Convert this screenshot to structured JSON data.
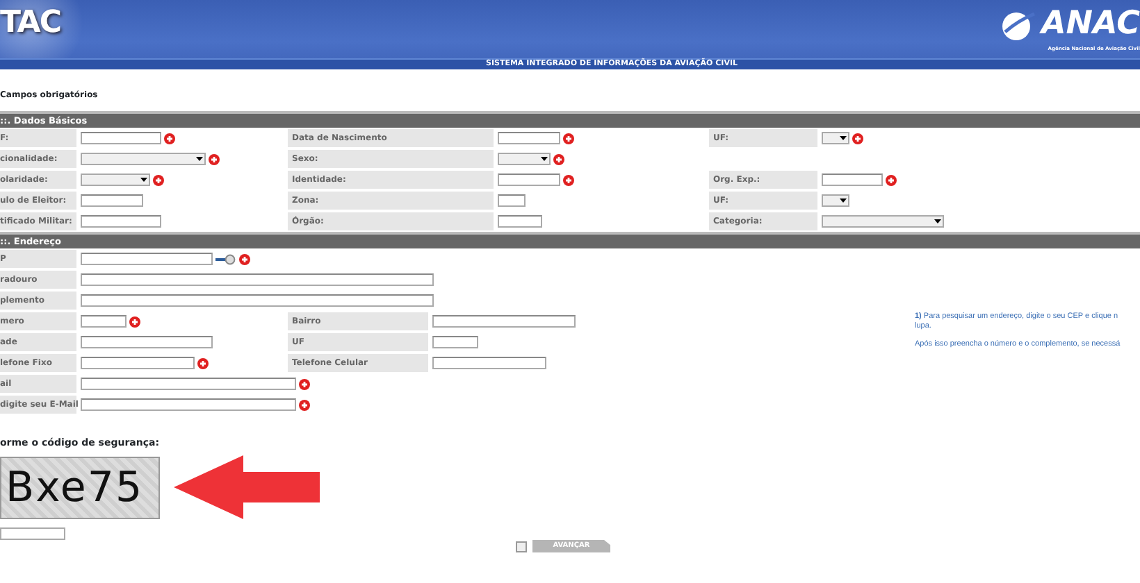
{
  "header": {
    "logo": "TAC",
    "brand": "ANAC",
    "brand_sub": "Agência Nacional de Aviação Civil",
    "system_title": "SISTEMA INTEGRADO DE INFORMAÇÕES DA AVIAÇÃO CIVIL"
  },
  "required_note": "Campos obrigatórios",
  "sections": [
    {
      "title": "::. Dados Básicos",
      "rows": [
        {
          "pairs": [
            {
              "label": "F:",
              "field": {
                "kind": "text",
                "required": true
              }
            },
            {
              "label": "Data de Nascimento",
              "field": {
                "kind": "text",
                "required": true
              }
            },
            {
              "label": "UF:",
              "field": {
                "kind": "select",
                "required": true
              }
            }
          ]
        },
        {
          "pairs": [
            {
              "label": "cionalidade:",
              "field": {
                "kind": "select",
                "required": true
              }
            },
            {
              "label": "Sexo:",
              "field": {
                "kind": "select",
                "required": true
              }
            }
          ]
        },
        {
          "pairs": [
            {
              "label": "olaridade:",
              "field": {
                "kind": "select",
                "required": true
              }
            },
            {
              "label": "Identidade:",
              "field": {
                "kind": "text",
                "required": true
              }
            },
            {
              "label": "Org. Exp.:",
              "field": {
                "kind": "text",
                "required": true
              }
            }
          ]
        },
        {
          "pairs": [
            {
              "label": "ulo de Eleitor:",
              "field": {
                "kind": "text",
                "required": false
              }
            },
            {
              "label": "Zona:",
              "field": {
                "kind": "text",
                "required": false
              }
            },
            {
              "label": "UF:",
              "field": {
                "kind": "select",
                "required": false
              }
            }
          ]
        },
        {
          "pairs": [
            {
              "label": "tificado Militar:",
              "field": {
                "kind": "text",
                "required": false
              }
            },
            {
              "label": "Órgão:",
              "field": {
                "kind": "text",
                "required": false
              }
            },
            {
              "label": "Categoria:",
              "field": {
                "kind": "select",
                "required": false
              }
            }
          ]
        }
      ]
    },
    {
      "title": "::. Endereço",
      "rows": [
        {
          "pairs": [
            {
              "label": "P",
              "field": {
                "kind": "text",
                "required": true,
                "lookup": true
              }
            }
          ]
        },
        {
          "pairs": [
            {
              "label": "radouro",
              "field": {
                "kind": "text",
                "required": false
              }
            }
          ]
        },
        {
          "pairs": [
            {
              "label": "plemento",
              "field": {
                "kind": "text",
                "required": false
              }
            }
          ]
        },
        {
          "pairs": [
            {
              "label": "mero",
              "field": {
                "kind": "text",
                "required": true
              }
            },
            {
              "label": "Bairro",
              "field": {
                "kind": "text",
                "required": false
              }
            }
          ]
        },
        {
          "pairs": [
            {
              "label": "ade",
              "field": {
                "kind": "text",
                "required": false
              }
            },
            {
              "label": "UF",
              "field": {
                "kind": "text",
                "required": false
              }
            }
          ]
        },
        {
          "pairs": [
            {
              "label": "lefone Fixo",
              "field": {
                "kind": "text",
                "required": true
              }
            },
            {
              "label": "Telefone Celular",
              "field": {
                "kind": "text",
                "required": false
              }
            }
          ]
        },
        {
          "pairs": [
            {
              "label": "ail",
              "field": {
                "kind": "text",
                "required": true
              }
            }
          ]
        },
        {
          "pairs": [
            {
              "label": "digite seu E-Mail",
              "field": {
                "kind": "text",
                "required": true
              }
            }
          ]
        }
      ],
      "help": [
        {
          "lines": [
            "**1)** Para pesquisar um endereço, digite o seu CEP e clique n",
            "lupa."
          ]
        },
        {
          "lines": [
            "Após isso preencha o número e o complemento, se necessá"
          ]
        }
      ]
    }
  ],
  "captcha": {
    "label": "orme o código de segurança:",
    "text": "Bxe75"
  },
  "submit": {
    "label": "AVANÇAR",
    "disabled": true
  }
}
